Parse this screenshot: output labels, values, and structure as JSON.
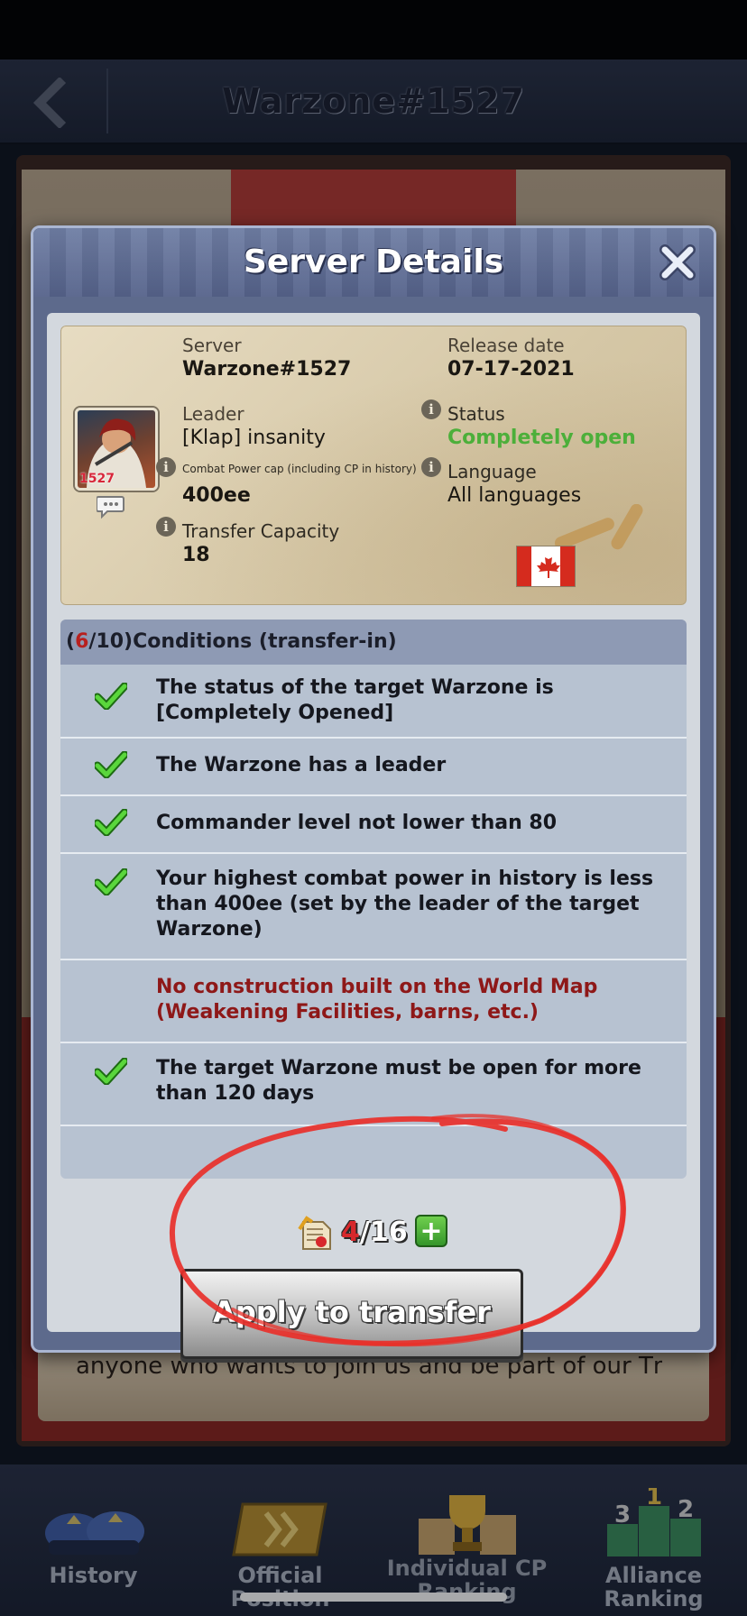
{
  "top_bar": {
    "title": "Warzone#1527"
  },
  "background": {
    "card_text": "anyone who wants to join us and be part of our Tm"
  },
  "modal": {
    "title": "Server Details",
    "info": {
      "server_label": "Server",
      "server_value": "Warzone#1527",
      "release_label": "Release date",
      "release_value": "07-17-2021",
      "leader_label": "Leader",
      "leader_value": "[Klap] insanity",
      "avatar_badge": "1527",
      "status_label": "Status",
      "status_value": "Completely open",
      "cp_cap_label": "Combat Power cap (including CP in history)",
      "cp_cap_value": "400ee",
      "language_label": "Language",
      "language_value": "All languages",
      "transfer_label": "Transfer Capacity",
      "transfer_value": "18"
    },
    "conditions": {
      "met": "6",
      "total": "10",
      "title": "Conditions (transfer-in)",
      "items": [
        {
          "text": "The status of the target Warzone is [Completely Opened]",
          "met": true
        },
        {
          "text": "The Warzone has a leader",
          "met": true
        },
        {
          "text": "Commander level not lower than 80",
          "met": true
        },
        {
          "text": "Your highest combat power in history is less than 400ee (set by the leader of the target Warzone)",
          "met": true
        },
        {
          "text": "No construction built on the World Map (Weakening Facilities, barns, etc.)",
          "met": false
        },
        {
          "text": "The target Warzone must be open for more than 120 days",
          "met": true
        }
      ]
    },
    "quota": {
      "current": "4",
      "max": "/16",
      "plus": "+"
    },
    "apply_label": "Apply to transfer"
  },
  "bottom_nav": [
    {
      "label": "History"
    },
    {
      "label": "Official Position"
    },
    {
      "label": "Individual CP Ranking"
    },
    {
      "label": "Alliance Ranking"
    }
  ],
  "colors": {
    "status_open": "#4caf3a",
    "fail_text": "#8e1818",
    "annotation": "#e8302a",
    "modal_frame": "#5d6a8c"
  }
}
